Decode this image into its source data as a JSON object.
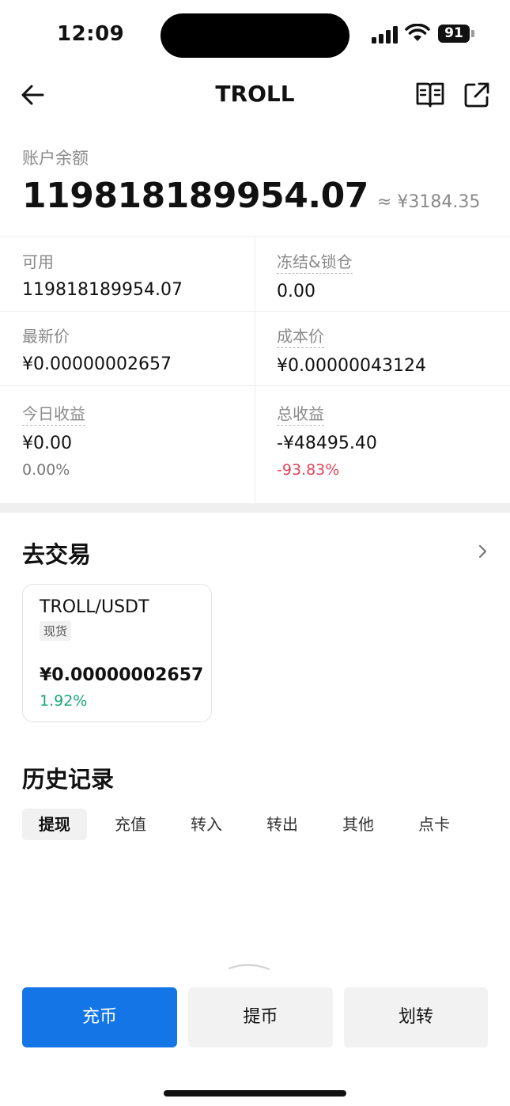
{
  "status_bar": {
    "time": "12:09",
    "battery": "91"
  },
  "nav": {
    "title": "TROLL",
    "icons": [
      "back-arrow-icon",
      "book-icon",
      "share-external-icon"
    ]
  },
  "balance": {
    "label": "账户余额",
    "value": "119818189954.07",
    "approx": "≈ ¥3184.35"
  },
  "stats": {
    "available": {
      "label": "可用",
      "value": "119818189954.07"
    },
    "frozen": {
      "label": "冻结&锁仓",
      "value": "0.00"
    },
    "latest_price": {
      "label": "最新价",
      "value": "¥0.00000002657"
    },
    "cost_price": {
      "label": "成本价",
      "value": "¥0.00000043124"
    },
    "today_pnl": {
      "label": "今日收益",
      "value": "¥0.00",
      "pct": "0.00%"
    },
    "total_pnl": {
      "label": "总收益",
      "value": "-¥48495.40",
      "pct": "-93.83%"
    }
  },
  "trade": {
    "title": "去交易",
    "card": {
      "pair": "TROLL/USDT",
      "tag": "现货",
      "price": "¥0.00000002657",
      "change": "1.92%"
    }
  },
  "history": {
    "title": "历史记录",
    "tabs": [
      "提现",
      "充值",
      "转入",
      "转出",
      "其他",
      "点卡"
    ],
    "active_tab": "提现"
  },
  "actions": {
    "deposit": "充币",
    "withdraw": "提币",
    "transfer": "划转"
  },
  "colors": {
    "primary": "#1476e6",
    "negative": "#e5435a",
    "positive": "#1aa57a"
  }
}
